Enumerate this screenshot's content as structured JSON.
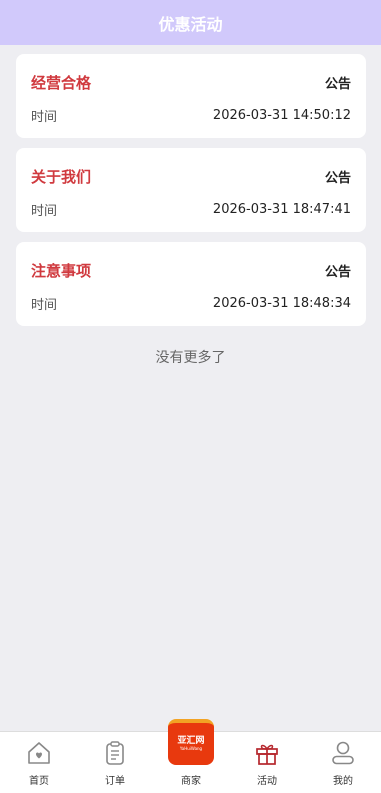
{
  "header": {
    "title": "优惠活动"
  },
  "notices": [
    {
      "title": "经营合格",
      "type": "公告",
      "time_label": "时间",
      "time": "2026-03-31 14:50:12"
    },
    {
      "title": "关于我们",
      "type": "公告",
      "time_label": "时间",
      "time": "2026-03-31 18:47:41"
    },
    {
      "title": "注意事项",
      "type": "公告",
      "time_label": "时间",
      "time": "2026-03-31 18:48:34"
    }
  ],
  "list_end_text": "没有更多了",
  "tabbar": {
    "items": [
      {
        "label": "首页",
        "icon": "home-icon"
      },
      {
        "label": "订单",
        "icon": "clipboard-icon"
      },
      {
        "label": "商家",
        "icon": "merchant-logo"
      },
      {
        "label": "活动",
        "icon": "gift-icon",
        "active": true
      },
      {
        "label": "我的",
        "icon": "user-icon"
      }
    ],
    "merchant_logo_text": "亚汇网",
    "merchant_logo_subtext": "YaHuiWang",
    "active_color": "#b6272d",
    "inactive_color": "#888888"
  },
  "colors": {
    "header_bg": "#d1c9fb",
    "page_bg": "#eeeef2",
    "notice_title": "#d03a3f"
  }
}
